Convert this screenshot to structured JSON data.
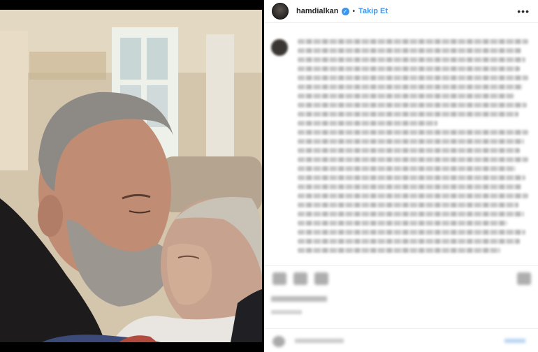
{
  "post": {
    "username": "hamdialkan",
    "verified_badge": "verified-icon",
    "separator": "•",
    "follow_label": "Takip Et",
    "more_icon": "•••"
  },
  "colors": {
    "link_blue": "#3897f0",
    "text_dark": "#262626",
    "divider": "#efefef"
  },
  "caption": {
    "blurred": true,
    "line_count": 24
  }
}
